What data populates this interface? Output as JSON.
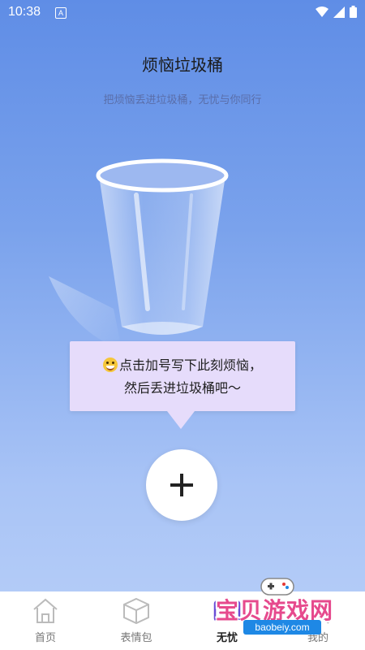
{
  "status_bar": {
    "time": "10:38",
    "notif_letter": "A"
  },
  "header": {
    "title": "烦恼垃圾桶",
    "subtitle": "把烦恼丢进垃圾桶，无忧与你同行"
  },
  "hint": {
    "line1": "点击加号写下此刻烦恼，",
    "line2": "然后丢进垃圾桶吧～",
    "emoji_icon": "grinning-face-icon"
  },
  "nav": {
    "items": [
      {
        "label": "首页",
        "icon": "home-icon"
      },
      {
        "label": "表情包",
        "icon": "box-icon"
      },
      {
        "label": "无忧",
        "icon": "gamepad-icon",
        "active": true
      },
      {
        "label": "我的",
        "icon": "user-icon"
      }
    ]
  },
  "watermark": {
    "text": "宝贝游戏网",
    "url": "baobeiy.com"
  },
  "colors": {
    "bg_top": "#5f8de6",
    "bg_bottom": "#b8cff8",
    "bubble": "#e6dcfb"
  }
}
